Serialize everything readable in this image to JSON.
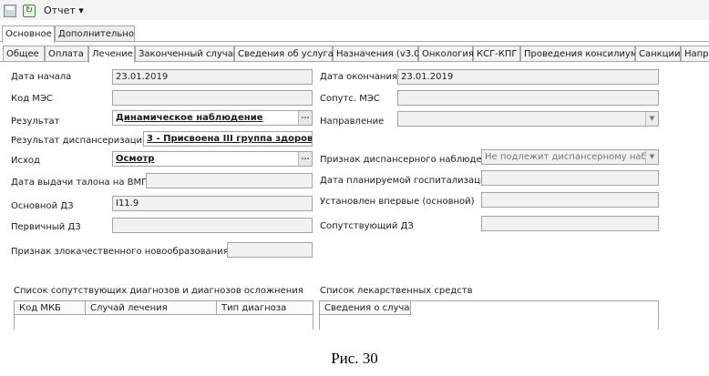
{
  "toolbar": {
    "save_icon": "save-icon",
    "refresh_icon": "refresh-icon",
    "report_label": "Отчет ▾"
  },
  "outer_tabs": [
    "Основное",
    "Дополнительно"
  ],
  "inner_tabs": [
    "Общее",
    "Оплата",
    "Лечение",
    "Законченный случай",
    "Сведения об услугах",
    "Назначения (v3.0)",
    "Онкология",
    "КСГ-КПГ",
    "Проведения консилиума",
    "Санкции",
    "Напр"
  ],
  "form": {
    "start_date_label": "Дата начала",
    "start_date_value": "23.01.2019",
    "end_date_label": "Дата окончания",
    "end_date_value": "23.01.2019",
    "mes_label": "Код МЭС",
    "mes_value": "",
    "comorbid_mes_label": "Сопутс. МЭС",
    "comorbid_mes_value": "",
    "result_label": "Результат",
    "result_value": "Динамическое наблюдение",
    "direction_label": "Направление",
    "direction_value": "",
    "dispensary_result_label": "Результат диспансеризации",
    "dispensary_result_value": "3 - Присвоена III группа здоров",
    "outcome_label": "Исход",
    "outcome_value": "Осмотр",
    "dispensary_sign_label": "Признак диспансерного наблюдения",
    "dispensary_sign_value": "Не подлежит диспансерному наблюд",
    "vmp_date_label": "Дата выдачи талона на ВМП",
    "vmp_date_value": "",
    "planned_hosp_label": "Дата планируемой госпитализации",
    "planned_hosp_value": "",
    "main_diag_label": "Основной ДЗ",
    "main_diag_value": "I11.9",
    "first_time_label": "Установлен впервые (основной)",
    "first_time_value": "",
    "primary_diag_label": "Первичный ДЗ",
    "primary_diag_value": "",
    "comorbid_diag_label": "Сопутствующий ДЗ",
    "comorbid_diag_value": "",
    "malignant_label": "Признак злокачественного новообразования",
    "malignant_value": ""
  },
  "diagnoses_list": {
    "title": "Список сопутствующих диагнозов и диагнозов осложнения",
    "columns": [
      "Код МКБ",
      "Случай лечения",
      "Тип диагноза"
    ]
  },
  "drugs_list": {
    "title": "Список лекарственных средств",
    "columns": [
      "Сведения о случае"
    ]
  },
  "caption": "Рис. 30"
}
